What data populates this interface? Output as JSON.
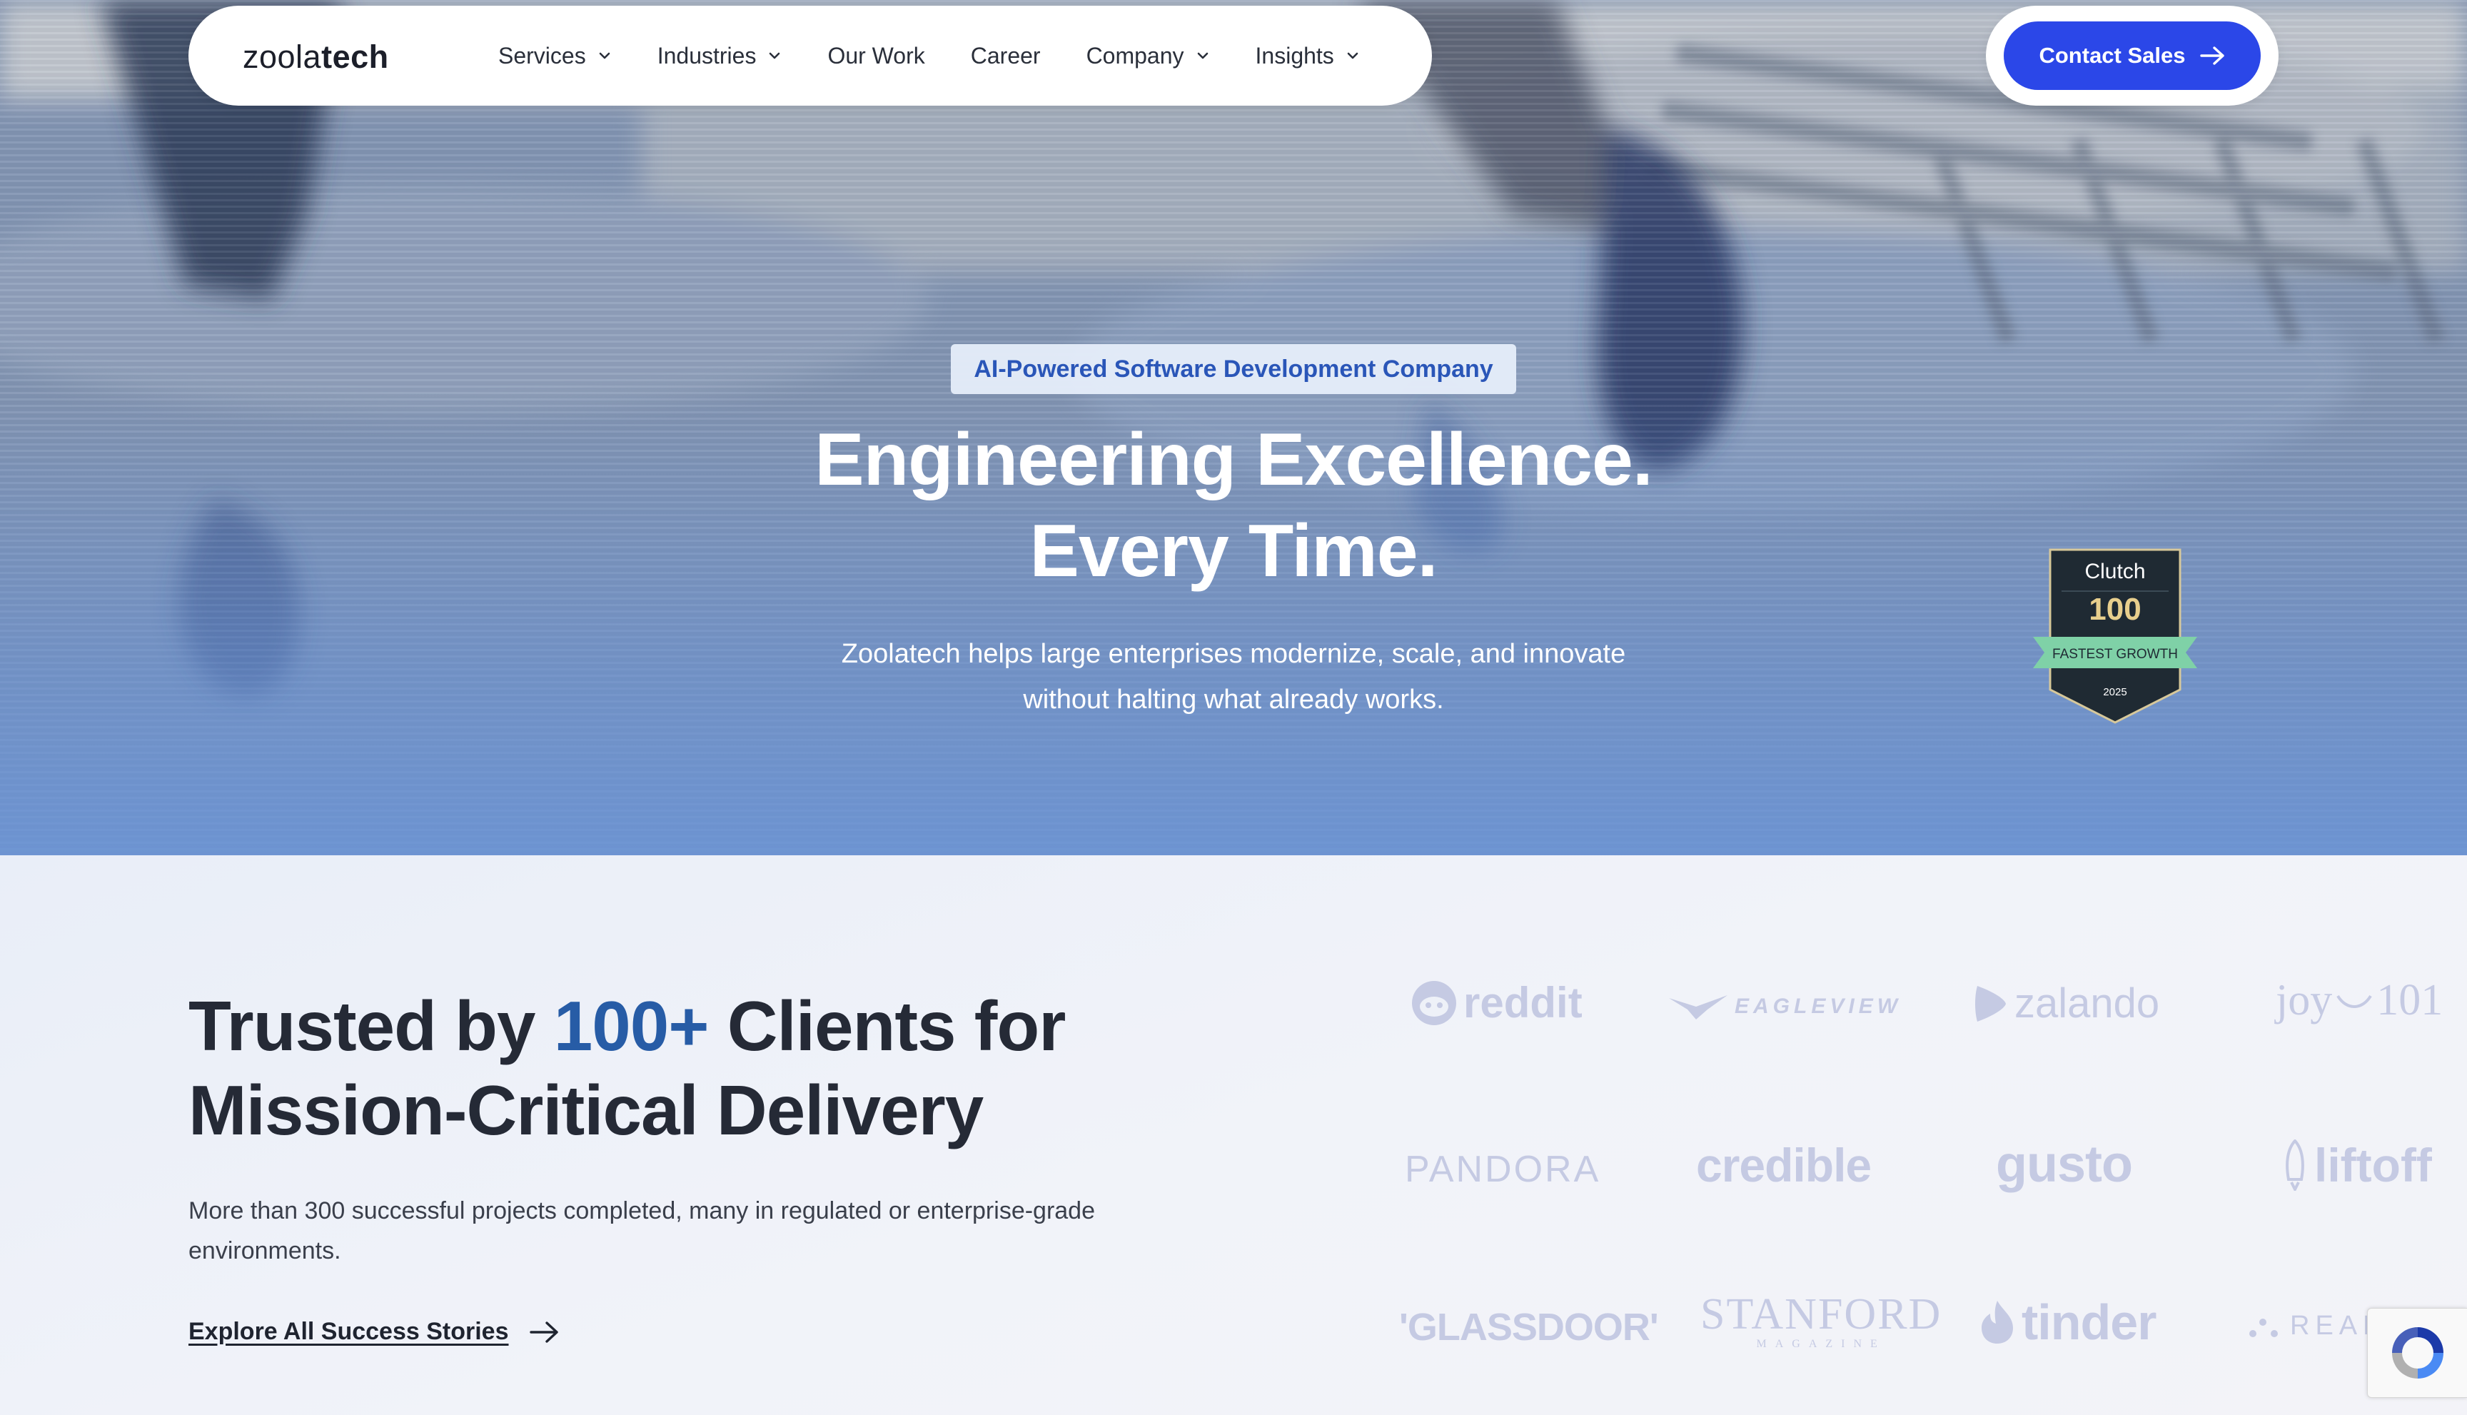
{
  "nav": {
    "logo_light": "zoola",
    "logo_bold": "tech",
    "items": [
      {
        "label": "Services",
        "has_dropdown": true
      },
      {
        "label": "Industries",
        "has_dropdown": true
      },
      {
        "label": "Our Work",
        "has_dropdown": false
      },
      {
        "label": "Career",
        "has_dropdown": false
      },
      {
        "label": "Company",
        "has_dropdown": true
      },
      {
        "label": "Insights",
        "has_dropdown": true
      }
    ],
    "cta_label": "Contact Sales"
  },
  "hero": {
    "eyebrow": "AI-Powered Software Development Company",
    "headline_line1": "Engineering Excellence.",
    "headline_line2": "Every Time.",
    "sub_line1": "Zoolatech helps large enterprises modernize, scale, and innovate",
    "sub_line2": "without halting what already works."
  },
  "badge": {
    "brand": "Clutch",
    "number": "100",
    "ribbon": "FASTEST GROWTH",
    "year": "2025"
  },
  "clients": {
    "title_part1": "Trusted by ",
    "title_accent": "100+",
    "title_part2": " Clients for",
    "title_line2": "Mission-Critical Delivery",
    "description": "More than 300 successful projects completed, many in regulated or enterprise-grade environments.",
    "link_label": "Explore All Success Stories",
    "logos": [
      "reddit",
      "EAGLEVIEW",
      "zalando",
      "joy",
      "101",
      "PANDORA",
      "credible",
      "gusto",
      "liftoff",
      "'GLASSDOOR'",
      "STANFORD",
      "MAGAZINE",
      "tinder",
      "REAL"
    ]
  },
  "colors": {
    "primary": "#2b47e8",
    "accent_text": "#275ca6",
    "eyebrow_text": "#2a56b8",
    "logo_gray": "#c5cae3"
  }
}
